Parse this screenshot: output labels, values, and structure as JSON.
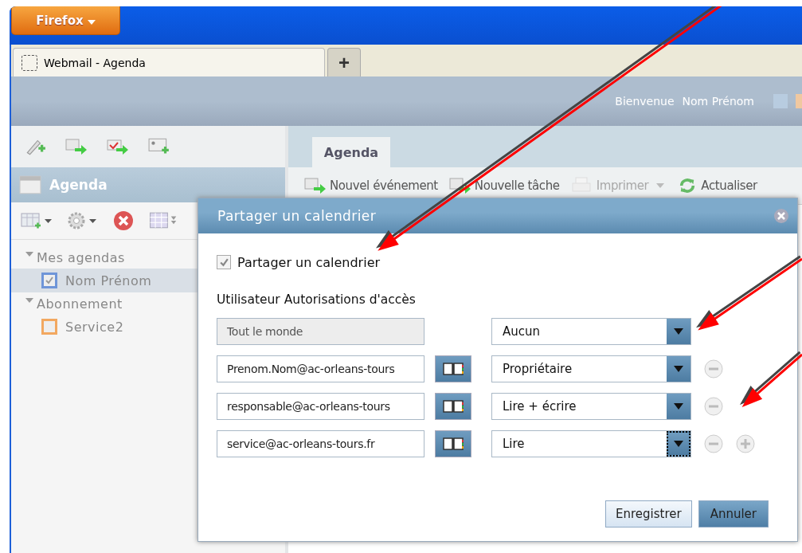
{
  "browser": {
    "menu_button": "Firefox",
    "tab": "Webmail  -  Agenda",
    "new_tab": "+"
  },
  "header": {
    "greeting": "Bienvenue",
    "user": "Nom Prénom"
  },
  "sidebar": {
    "title": "Agenda",
    "tree": [
      {
        "label": "Mes agendas",
        "expanded": true,
        "children": [
          {
            "label": "Nom Prénom",
            "checked": true,
            "selected": true,
            "color": "#6f95d8"
          }
        ]
      },
      {
        "label": "Abonnement",
        "expanded": true,
        "children": [
          {
            "label": "Service2",
            "checked": false,
            "selected": false,
            "color": "#f2a860"
          }
        ]
      }
    ]
  },
  "main": {
    "tabs": [
      {
        "label": "Agenda",
        "selected": true
      }
    ],
    "toolbar": [
      {
        "kind": "event",
        "label": "Nouvel événement",
        "disabled": false
      },
      {
        "kind": "task",
        "label": "Nouvelle tâche",
        "disabled": false
      },
      {
        "kind": "print",
        "label": "Imprimer",
        "disabled": true
      },
      {
        "kind": "refresh",
        "label": "Actualiser",
        "disabled": false
      }
    ]
  },
  "dialog": {
    "title": "Partager un calendrier",
    "share": {
      "label": "Partager un calendrier",
      "checked": true
    },
    "columns": [
      "Utilisateur",
      "Autorisations d'accès"
    ],
    "rows": [
      {
        "kind": "everyone",
        "user": "Tout le monde",
        "permission": "Aucun",
        "focused": false,
        "add": false
      },
      {
        "kind": "user",
        "user": "Prenom.Nom@ac-orleans-tours",
        "permission": "Propriétaire",
        "focused": false,
        "add": false
      },
      {
        "kind": "user",
        "user": "responsable@ac-orleans-tours",
        "permission": "Lire + écrire",
        "focused": false,
        "add": false
      },
      {
        "kind": "user",
        "user": "service@ac-orleans-tours.fr",
        "permission": "Lire",
        "focused": true,
        "add": true
      }
    ],
    "buttons": [
      {
        "label": "Enregistrer",
        "primary": false
      },
      {
        "label": "Annuler",
        "primary": true
      }
    ]
  }
}
